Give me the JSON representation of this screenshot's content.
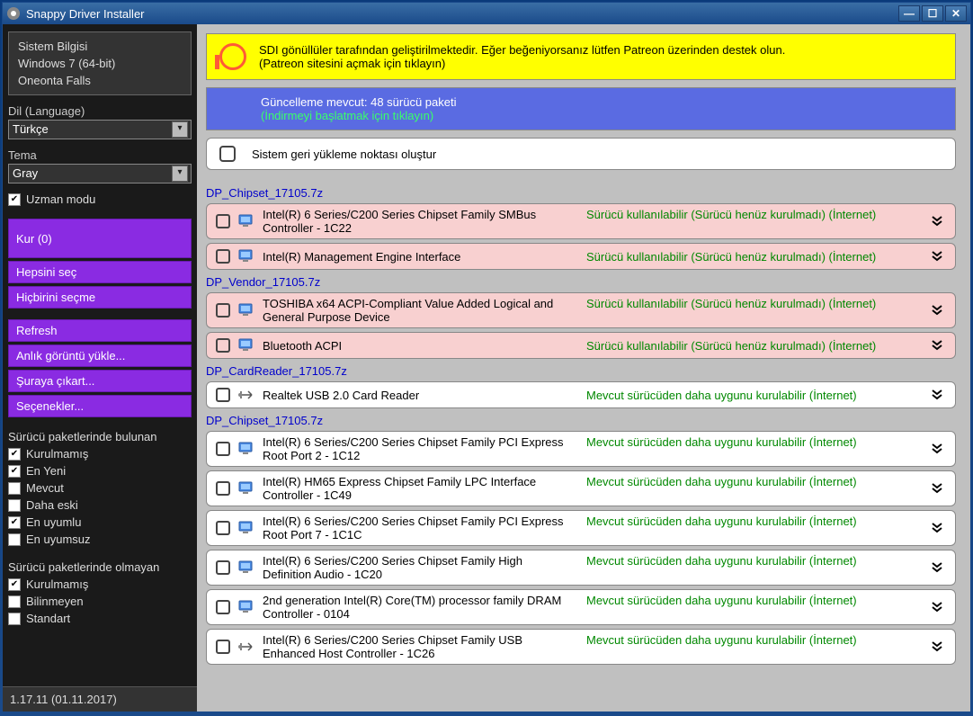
{
  "window": {
    "title": "Snappy Driver Installer"
  },
  "sysinfo": {
    "l1": "Sistem Bilgisi",
    "l2": "Windows 7 (64-bit)",
    "l3": "Oneonta Falls"
  },
  "lang": {
    "label": "Dil (Language)",
    "value": "Türkçe"
  },
  "tema": {
    "label": "Tema",
    "value": "Gray"
  },
  "uzman": "Uzman modu",
  "buttons": {
    "kur": "Kur (0)",
    "hepsini": "Hepsini seç",
    "hicbirini": "Hiçbirini seçme",
    "refresh": "Refresh",
    "anlik": "Anlık görüntü yükle...",
    "suraya": "Şuraya çıkart...",
    "secenekler": "Seçenekler..."
  },
  "filters1": {
    "title": "Sürücü paketlerinde bulunan",
    "f1": "Kurulmamış",
    "f2": "En Yeni",
    "f3": "Mevcut",
    "f4": "Daha eski",
    "f5": "En uyumlu",
    "f6": "En uyumsuz"
  },
  "filters2": {
    "title": "Sürücü paketlerinde olmayan",
    "f1": "Kurulmamış",
    "f2": "Bilinmeyen",
    "f3": "Standart"
  },
  "version": "1.17.11 (01.11.2017)",
  "banner_yellow": {
    "l1": "SDI gönüllüler tarafından geliştirilmektedir. Eğer beğeniyorsanız lütfen Patreon üzerinden destek olun.",
    "l2": "(Patreon sitesini açmak için tıklayın)"
  },
  "banner_blue": {
    "l1": "Güncelleme mevcut: 48 sürücü paketi",
    "l2": "(İndirmeyi başlatmak için tıklayın)"
  },
  "restore": "Sistem geri yükleme noktası oluştur",
  "status_pink": "Sürücü kullanılabilir (Sürücü henüz kurulmadı) (İnternet)",
  "status_green": "Mevcut sürücüden daha uygunu kurulabilir (İnternet)",
  "groups": [
    {
      "title": "DP_Chipset_17105.7z",
      "pink": true,
      "items": [
        {
          "name": "Intel(R) 6 Series/C200 Series Chipset Family SMBus Controller - 1C22",
          "icon": "monitor"
        },
        {
          "name": "Intel(R) Management Engine Interface",
          "icon": "monitor"
        }
      ]
    },
    {
      "title": "DP_Vendor_17105.7z",
      "pink": true,
      "items": [
        {
          "name": "TOSHIBA x64 ACPI-Compliant Value Added Logical and General Purpose Device",
          "icon": "monitor"
        },
        {
          "name": "Bluetooth ACPI",
          "icon": "monitor"
        }
      ]
    },
    {
      "title": "DP_CardReader_17105.7z",
      "pink": false,
      "items": [
        {
          "name": "Realtek USB 2.0 Card Reader",
          "icon": "usb"
        }
      ]
    },
    {
      "title": "DP_Chipset_17105.7z",
      "pink": false,
      "items": [
        {
          "name": "Intel(R) 6 Series/C200 Series Chipset Family PCI Express Root Port 2 - 1C12",
          "icon": "monitor"
        },
        {
          "name": "Intel(R) HM65 Express Chipset Family LPC Interface Controller - 1C49",
          "icon": "monitor"
        },
        {
          "name": "Intel(R) 6 Series/C200 Series Chipset Family PCI Express Root Port 7 - 1C1C",
          "icon": "monitor"
        },
        {
          "name": "Intel(R) 6 Series/C200 Series Chipset Family High Definition Audio - 1C20",
          "icon": "monitor"
        },
        {
          "name": "2nd generation Intel(R) Core(TM) processor family DRAM Controller - 0104",
          "icon": "monitor"
        },
        {
          "name": "Intel(R) 6 Series/C200 Series Chipset Family USB Enhanced Host Controller - 1C26",
          "icon": "usb"
        }
      ]
    }
  ]
}
